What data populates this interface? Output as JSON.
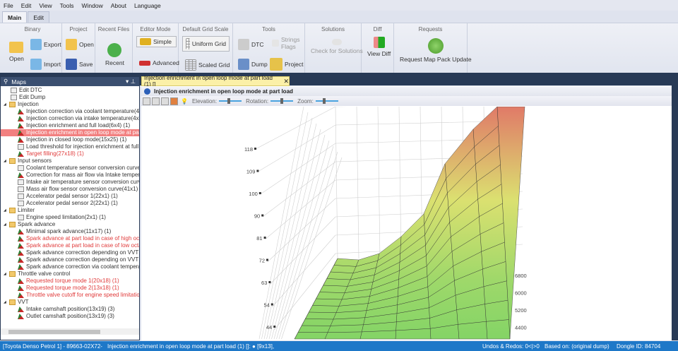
{
  "menu": [
    "File",
    "Edit",
    "View",
    "Tools",
    "Window",
    "About",
    "Language"
  ],
  "ribbon_tabs": [
    "Main",
    "Edit"
  ],
  "ribbon": {
    "binary": {
      "label": "Binary",
      "open": "Open",
      "export": "Export",
      "import": "Import"
    },
    "project": {
      "label": "Project",
      "open": "Open",
      "save": "Save"
    },
    "recent": {
      "label": "Recent Files",
      "recent": "Recent"
    },
    "editor_mode": {
      "label": "Editor Mode",
      "simple": "Simple",
      "advanced": "Advanced"
    },
    "grid_scale": {
      "label": "Default Grid Scale",
      "uniform": "Uniform Grid",
      "scaled": "Scaled Grid"
    },
    "tools": {
      "label": "Tools",
      "dtc": "DTC",
      "strings": "Strings",
      "flags": "Flags",
      "dump": "Dump",
      "project": "Project"
    },
    "solutions": {
      "label": "Solutions",
      "check": "Check for Solutions"
    },
    "diff": {
      "label": "Diff",
      "view": "View Diff"
    },
    "requests": {
      "label": "Requests",
      "update": "Request Map Pack Update"
    }
  },
  "maps_panel": {
    "title": "Maps",
    "items": [
      {
        "t": "Edit DTC",
        "lvl": 1,
        "type": "dtc"
      },
      {
        "t": "Edit Dump",
        "lvl": 1,
        "type": "dump"
      },
      {
        "t": "Injection",
        "lvl": 0,
        "type": "folder"
      },
      {
        "t": "Injection correction via coolant temperature(4x1",
        "lvl": 1,
        "type": "map"
      },
      {
        "t": "Injection correction via intake temperature(4x15)",
        "lvl": 1,
        "type": "map"
      },
      {
        "t": "Injection enrichment and full load(6x4) (1)",
        "lvl": 1,
        "type": "map"
      },
      {
        "t": "Injection enrichment in open loop mode at part l",
        "lvl": 1,
        "type": "map",
        "selected": true
      },
      {
        "t": "Injection in closed loop mode(15x25) (1)",
        "lvl": 1,
        "type": "map"
      },
      {
        "t": "Load threshold for injection enrichment at full lo",
        "lvl": 1,
        "type": "curve"
      },
      {
        "t": "Target filling(27x18) (1)",
        "lvl": 1,
        "type": "map",
        "red": true
      },
      {
        "t": "Input sensors",
        "lvl": 0,
        "type": "folder"
      },
      {
        "t": "Coolant temperature sensor conversion curve(22",
        "lvl": 1,
        "type": "curve"
      },
      {
        "t": "Correction for mass air flow via Intake temperatu",
        "lvl": 1,
        "type": "map"
      },
      {
        "t": "Intake air temperature sensor conversion curve(2",
        "lvl": 1,
        "type": "curve"
      },
      {
        "t": "Mass air flow sensor conversion curve(41x1) (1)",
        "lvl": 1,
        "type": "curve"
      },
      {
        "t": "Accelerator pedal sensor 1(22x1) (1)",
        "lvl": 1,
        "type": "curve"
      },
      {
        "t": "Accelerator pedal sensor 2(22x1) (1)",
        "lvl": 1,
        "type": "curve"
      },
      {
        "t": "Limiter",
        "lvl": 0,
        "type": "folder"
      },
      {
        "t": "Engine speed limitation(2x1) (1)",
        "lvl": 1,
        "type": "curve"
      },
      {
        "t": "Spark advance",
        "lvl": 0,
        "type": "folder"
      },
      {
        "t": "Minimal spark advance(11x17) (1)",
        "lvl": 1,
        "type": "map"
      },
      {
        "t": "Spark advance at part load in case of high octane",
        "lvl": 1,
        "type": "map",
        "red": true
      },
      {
        "t": "Spark advance at part load in case of low octane",
        "lvl": 1,
        "type": "map",
        "red": true
      },
      {
        "t": "Spark advance correction depending on VVT pos",
        "lvl": 1,
        "type": "map"
      },
      {
        "t": "Spark advance correction depending on VVT pos",
        "lvl": 1,
        "type": "map"
      },
      {
        "t": "Spark advance correction via coolant temperatur",
        "lvl": 1,
        "type": "map"
      },
      {
        "t": "Throttle valve control",
        "lvl": 0,
        "type": "folder"
      },
      {
        "t": "Requested torque mode 1(20x18) (1)",
        "lvl": 1,
        "type": "map",
        "red": true
      },
      {
        "t": "Requested torque mode 2(13x18) (1)",
        "lvl": 1,
        "type": "map",
        "red": true
      },
      {
        "t": "Throttle valve cutoff for engine speed limitation(",
        "lvl": 1,
        "type": "map",
        "red": true
      },
      {
        "t": "VVT",
        "lvl": 0,
        "type": "folder"
      },
      {
        "t": "Intake camshaft position(13x19) (3)",
        "lvl": 1,
        "type": "map"
      },
      {
        "t": "Outlet camshaft position(13x19) (3)",
        "lvl": 1,
        "type": "map"
      }
    ]
  },
  "doc_tab": {
    "title": "Injection enrichment in open loop mode at part load (1) []",
    "close": "✕"
  },
  "view": {
    "title": "Injection enrichment in open loop mode at part load",
    "elevation": "Elevation:",
    "rotation": "Rotation:",
    "zoom": "Zoom:",
    "z_ticks": [
      "118",
      "109",
      "100",
      "90",
      "81",
      "72",
      "63",
      "54",
      "44"
    ],
    "y_ticks": [
      "6800",
      "6000",
      "5200",
      "4400"
    ]
  },
  "status": {
    "ecu": "[Toyota Denso Petrol 1] - 89663-02X72-",
    "map": "Injection enrichment in open loop mode at part load (1) []: ● [9x13],",
    "undo": "Undos & Redos: 0<|>0",
    "based": "Based on: (original dump)",
    "dongle": "Dongle ID: 84704"
  },
  "colors": {
    "accent": "#1e78c8",
    "panel_dark": "#283a56",
    "selected": "#f28080",
    "red_text": "#e03a3a",
    "surface_high": "#e07a68",
    "surface_mid": "#dbe070",
    "surface_low": "#84d466"
  }
}
